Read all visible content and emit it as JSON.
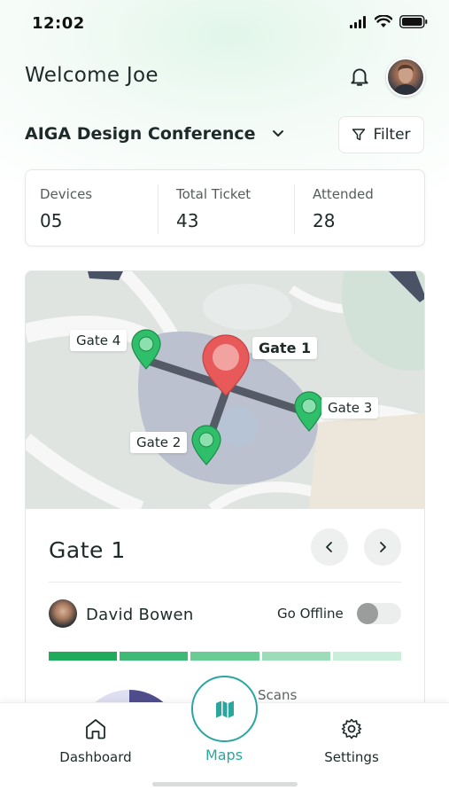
{
  "status_bar": {
    "time": "12:02"
  },
  "header": {
    "welcome": "Welcome Joe"
  },
  "event": {
    "name": "AIGA Design Conference",
    "filter_label": "Filter"
  },
  "stats": [
    {
      "label": "Devices",
      "value": "05"
    },
    {
      "label": "Total Ticket",
      "value": "43"
    },
    {
      "label": "Attended",
      "value": "28"
    }
  ],
  "map": {
    "gates": [
      {
        "label": "Gate 1",
        "selected": true
      },
      {
        "label": "Gate 2",
        "selected": false
      },
      {
        "label": "Gate 3",
        "selected": false
      },
      {
        "label": "Gate 4",
        "selected": false
      }
    ]
  },
  "gate_panel": {
    "title": "Gate 1",
    "person": "David Bowen",
    "offline_label": "Go Offline",
    "offline": false,
    "progress_segments": [
      "#1faa5c",
      "#3dbb76",
      "#69cc95",
      "#9ddcb8",
      "#cbeedb"
    ]
  },
  "scans_label": "Scans",
  "bottom_nav": {
    "dashboard": "Dashboard",
    "maps": "Maps",
    "settings": "Settings"
  },
  "colors": {
    "accent": "#2aa6a0",
    "gate_pin": "#2fbf6a",
    "selected_pin": "#e85a5a"
  },
  "icons": [
    "signal-icon",
    "wifi-icon",
    "battery-icon",
    "bell-icon",
    "filter-icon",
    "chevron-down-icon",
    "chevron-left-icon",
    "chevron-right-icon",
    "home-icon",
    "map-icon",
    "gear-icon",
    "map-pin-icon"
  ]
}
